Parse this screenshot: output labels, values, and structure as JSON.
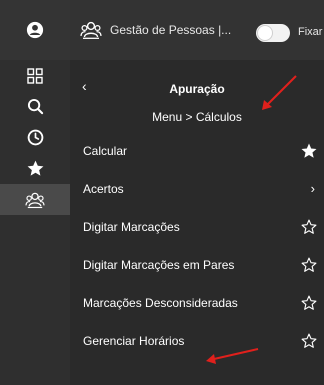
{
  "header": {
    "app_title": "Gestão de Pessoas |...",
    "fixar_label": "Fixar",
    "app_icon": "people-group-icon"
  },
  "rail": {
    "items": [
      {
        "icon": "user-circle-icon"
      },
      {
        "icon": "grid-icon"
      },
      {
        "icon": "search-icon"
      },
      {
        "icon": "clock-icon"
      },
      {
        "icon": "star-icon"
      },
      {
        "icon": "people-group-icon"
      }
    ]
  },
  "subheader": {
    "back": "‹",
    "title": "Apuração",
    "breadcrumb": "Menu  > Cálculos"
  },
  "menu": {
    "items": [
      {
        "label": "Calcular",
        "right": "star-filled"
      },
      {
        "label": "Acertos",
        "right": "chevron"
      },
      {
        "label": "Digitar Marcações",
        "right": "star-outline"
      },
      {
        "label": "Digitar Marcações em Pares",
        "right": "star-outline"
      },
      {
        "label": "Marcações Desconsideradas",
        "right": "star-outline"
      },
      {
        "label": "Gerenciar Horários",
        "right": "star-outline"
      }
    ],
    "chevron": "›"
  },
  "colors": {
    "annotation_arrow": "#e0201c",
    "panel_bg": "#2a2a2a",
    "rail_bg": "#2f2f2f"
  }
}
